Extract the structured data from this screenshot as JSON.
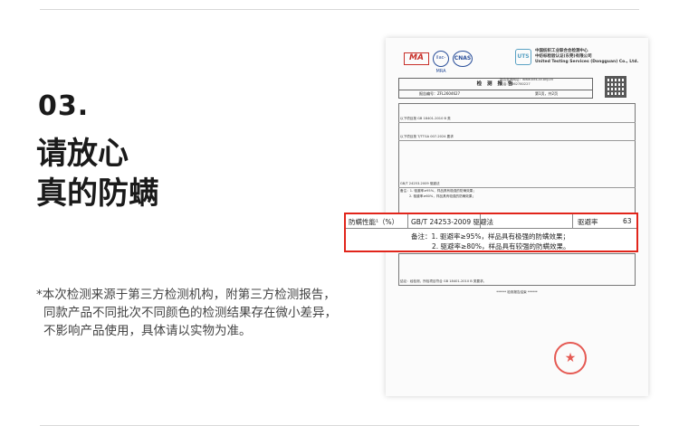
{
  "left": {
    "step": "03.",
    "heading_line1": "请放心",
    "heading_line2": "真的防螨",
    "note_line1": "*本次检测来源于第三方检测机构，附第三方检测报告，",
    "note_line2": "同款产品不同批次不同颜色的检测结果存在微小差异，",
    "note_line3": "不影响产品使用，具体请以实物为准。"
  },
  "report": {
    "logo_ma": "MA",
    "logo_ilac": "ilac-MRA",
    "logo_cnas": "CNAS",
    "lab_name_cn": "中国纺织工业联合会检测中心",
    "lab_name_cn2": "中纺标检验认证(东莞)有限公司",
    "lab_name_en": "United Testing Services (Dongguan) Co., Ltd.",
    "title": "检 测 报 告",
    "report_no_label": "报告编号：",
    "report_no": "ZFL2604627",
    "pages": "第1页，共2页",
    "contact_web": "报告查询网址：www.tcts-cz.org.cn",
    "contact_tel": "电话：0362780227",
    "row_standard1": "以下项目按 GB 18401-2010 B 类",
    "row_standard2": "以下项目按 T/TTGA 007-2024 要求",
    "row_mite_result": "GB/T 24253-2009 驱避法",
    "note_small1": "备注：1. 驱避率≥95%，样品具有极强的防螨效果；",
    "note_small2": "2. 驱避率≥60%，样品具有较强的防螨效果；",
    "conclusion": "结论：经检测，所检项目符合 GB 18401-2010 B 类要求。",
    "footer_line": "****** 检测报告结束 ******",
    "stamp_char": "★"
  },
  "highlight": {
    "item": "防螨性能¹（%）",
    "method": "GB/T 24253-2009  驱避法",
    "dash": "–",
    "metric": "驱避率",
    "value": "63",
    "note_line1": "备注：1. 驱避率≥95%，样品具有极强的防螨效果；",
    "note_line2": "2. 驱避率≥80%，样品具有较强的防螨效果。"
  },
  "colors": {
    "highlight_border": "#e1251b",
    "stamp": "#e0322a",
    "heading": "#1a1a1a"
  }
}
